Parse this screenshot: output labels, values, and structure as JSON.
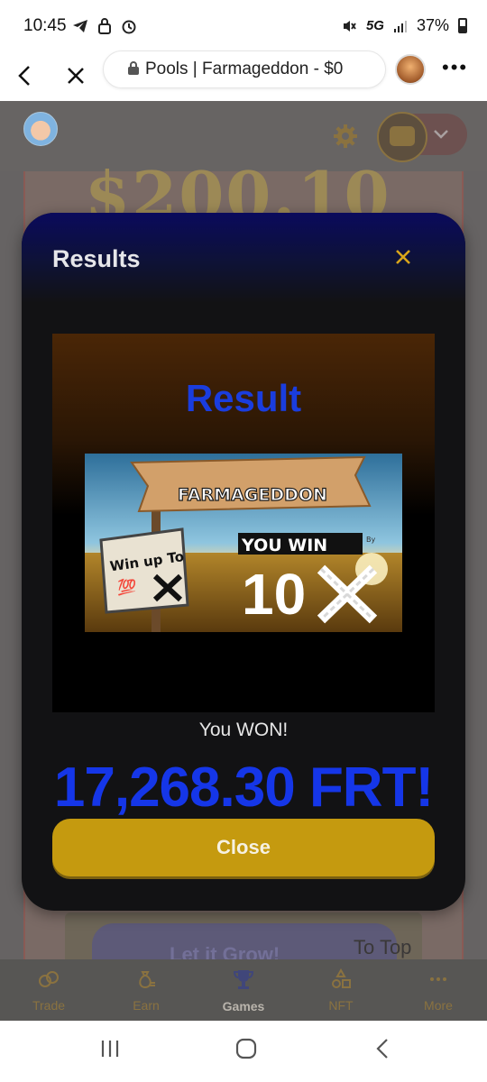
{
  "status_bar": {
    "time": "10:45",
    "network": "5G",
    "battery": "37%"
  },
  "browser": {
    "url_title": "Pools | Farmageddon - $0"
  },
  "page": {
    "big_amount": "$200.10",
    "bg_button_label": "Let it Grow!",
    "to_top": "To Top"
  },
  "modal": {
    "title": "Results",
    "result_heading": "Result",
    "banner": {
      "sign_text": "FARMAGEDDON",
      "card_text": "Win up To",
      "card_emoji": "💯",
      "you_win": "YOU WIN",
      "multiplier": "10",
      "by": "By"
    },
    "won_text": "You WON!",
    "won_amount": "17,268.30 FRT!",
    "close_label": "Close"
  },
  "tabbar": {
    "items": [
      {
        "label": "Trade",
        "icon": "trade-icon"
      },
      {
        "label": "Earn",
        "icon": "money-bag-icon"
      },
      {
        "label": "Games",
        "icon": "trophy-icon"
      },
      {
        "label": "NFT",
        "icon": "shapes-icon"
      },
      {
        "label": "More",
        "icon": "more-dots-icon"
      }
    ],
    "active": "Games"
  },
  "colors": {
    "accent_gold": "#c59a0f",
    "win_blue": "#1536e8",
    "modal_bg": "#121214"
  }
}
